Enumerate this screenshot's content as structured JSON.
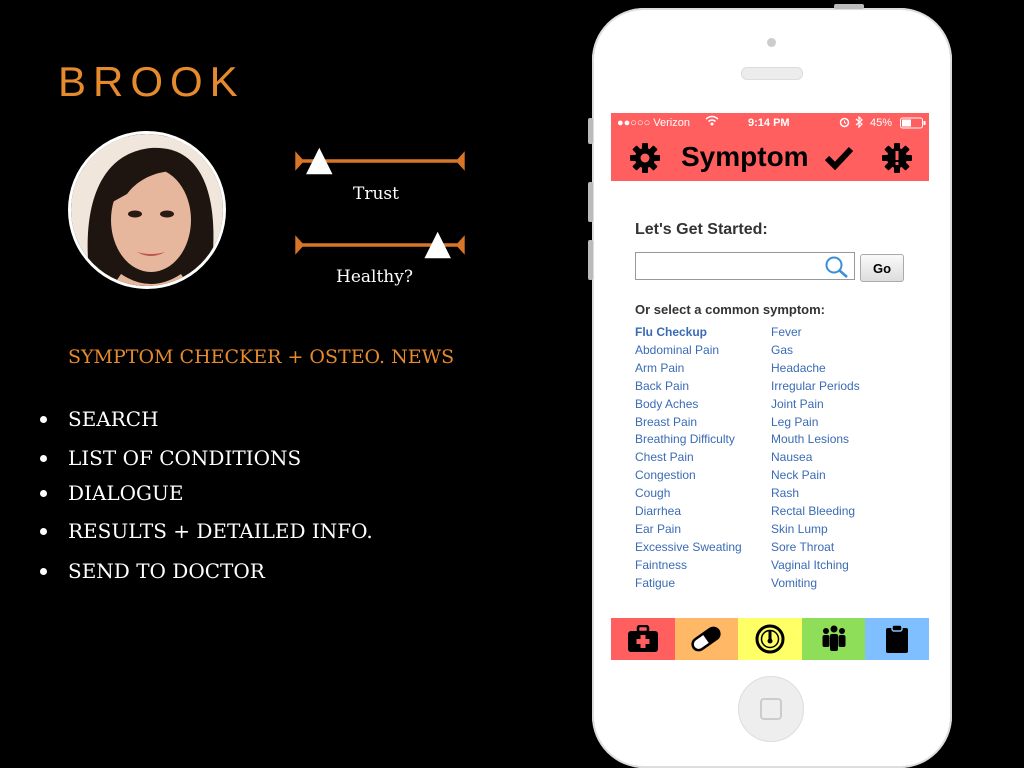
{
  "slide": {
    "persona_name": "BROOK",
    "scales": [
      {
        "label": "Trust",
        "level": 0.1
      },
      {
        "label": "Healthy?",
        "level": 0.88
      }
    ],
    "subtitle": "SYMPTOM CHECKER + OSTEO. NEWS",
    "bullets": [
      "SEARCH",
      "LIST OF CONDITIONS",
      "DIALOGUE",
      "RESULTS + DETAILED INFO.",
      "SEND TO DOCTOR"
    ]
  },
  "phone": {
    "status": {
      "carrier": "●●○○○ Verizon",
      "time": "9:14 PM",
      "battery": "45%"
    },
    "app_title": "Symptom",
    "get_started": "Let's Get Started:",
    "search": {
      "value": "",
      "go_label": "Go"
    },
    "common_heading": "Or select a common symptom:",
    "symptoms_left": [
      "Flu Checkup",
      "Abdominal Pain",
      "Arm Pain",
      "Back Pain",
      "Body Aches",
      "Breast Pain",
      "Breathing Difficulty",
      "Chest Pain",
      "Congestion",
      "Cough",
      "Diarrhea",
      "Ear Pain",
      "Excessive Sweating",
      "Faintness",
      "Fatigue"
    ],
    "symptoms_right": [
      "Fever",
      "Gas",
      "Headache",
      "Irregular Periods",
      "Joint Pain",
      "Leg Pain",
      "Mouth Lesions",
      "Nausea",
      "Neck Pain",
      "Rash",
      "Rectal Bleeding",
      "Skin Lump",
      "Sore Throat",
      "Vaginal Itching",
      "Vomiting"
    ],
    "tabs": [
      {
        "icon": "first-aid-kit-icon",
        "color": "#ff5f5f"
      },
      {
        "icon": "pill-icon",
        "color": "#ffb866"
      },
      {
        "icon": "gauge-icon",
        "color": "#ffff66"
      },
      {
        "icon": "people-icon",
        "color": "#8ede5a"
      },
      {
        "icon": "clipboard-icon",
        "color": "#7fbfff"
      }
    ]
  },
  "colors": {
    "accent": "#e68a2e",
    "app_red": "#ff5f5f",
    "link_blue": "#3a6bb5"
  }
}
